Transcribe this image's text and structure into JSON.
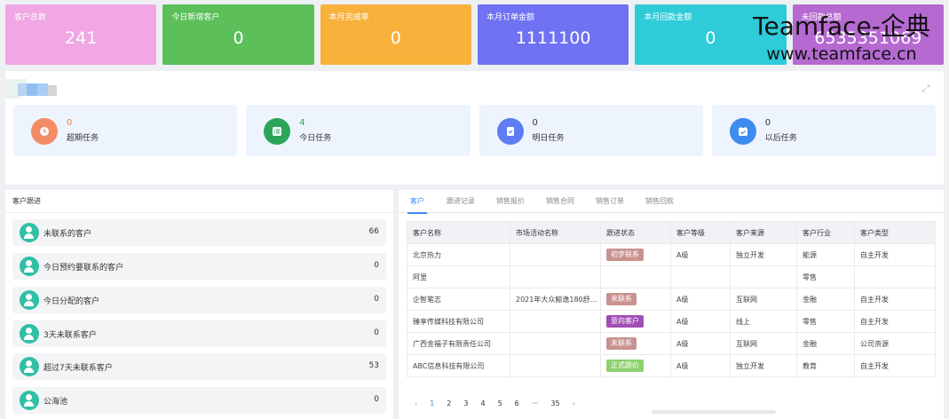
{
  "stats": [
    {
      "label": "客户总数",
      "value": "241",
      "color": "#f0a7e3"
    },
    {
      "label": "今日新增客户",
      "value": "0",
      "color": "#5cbf5a"
    },
    {
      "label": "本月完成率",
      "value": "0",
      "color": "#f8b13b"
    },
    {
      "label": "本月订单金额",
      "value": "1111100",
      "color": "#6f72f2"
    },
    {
      "label": "本月回款金额",
      "value": "0",
      "color": "#2fcbd9"
    },
    {
      "label": "未回款总额",
      "value": "6535351069",
      "color": "#b569d1"
    }
  ],
  "watermark": {
    "line1": "Teamface-企典",
    "line2": "www.teamface.cn"
  },
  "tasks": [
    {
      "count": "0",
      "name": "超期任务",
      "icon": "overdue-icon",
      "color": "#f38b66",
      "count_color": "#f37b3a"
    },
    {
      "count": "4",
      "name": "今日任务",
      "icon": "today-icon",
      "color": "#2ca55a",
      "count_color": "#2ca55a"
    },
    {
      "count": "0",
      "name": "明日任务",
      "icon": "tomorrow-icon",
      "color": "#5e7df2",
      "count_color": "#333333"
    },
    {
      "count": "0",
      "name": "以后任务",
      "icon": "later-icon",
      "color": "#3f8cf0",
      "count_color": "#333333"
    }
  ],
  "follow": {
    "title": "客户跟进",
    "rows": [
      {
        "label": "未联系的客户",
        "count": "66"
      },
      {
        "label": "今日预约要联系的客户",
        "count": "0"
      },
      {
        "label": "今日分配的客户",
        "count": "0"
      },
      {
        "label": "3天未联系客户",
        "count": "0"
      },
      {
        "label": "超过7天未联系客户",
        "count": "53"
      },
      {
        "label": "公海池",
        "count": "0"
      }
    ]
  },
  "tabs": [
    "客户",
    "跟进记录",
    "销售报价",
    "销售合同",
    "销售订单",
    "销售回款"
  ],
  "table": {
    "headers": [
      "客户名称",
      "市场活动名称",
      "跟进状态",
      "客户等级",
      "客户来源",
      "客户行业",
      "客户类型"
    ],
    "rows": [
      [
        "北京热力",
        "",
        "初步联系",
        "A级",
        "独立开发",
        "能源",
        "自主开发"
      ],
      [
        "阿里",
        "",
        "",
        "",
        "",
        "零售",
        ""
      ],
      [
        "企智笔志",
        "2021年大众鲸逸180舒...",
        "未联系",
        "A级",
        "互联网",
        "金融",
        "自主开发"
      ],
      [
        "臻享传媒科技有限公司",
        "",
        "意向客户",
        "A级",
        "线上",
        "零售",
        "自主开发"
      ],
      [
        "广西金福子有限责任公司",
        "",
        "未联系",
        "A级",
        "互联网",
        "金融",
        "公司资源"
      ],
      [
        "ABC信息科技有限公司",
        "",
        "正式跟价",
        "A级",
        "独立开发",
        "教育",
        "自主开发"
      ]
    ],
    "tag_colors": {
      "初步联系": "#c9928f",
      "未联系": "#c9928f",
      "意向客户": "#a04fb5",
      "正式跟价": "#8cd16e"
    }
  },
  "pager": {
    "prev": "‹",
    "pages": [
      "1",
      "2",
      "3",
      "4",
      "5",
      "6",
      "···",
      "35"
    ],
    "next": "›",
    "current": "1"
  }
}
